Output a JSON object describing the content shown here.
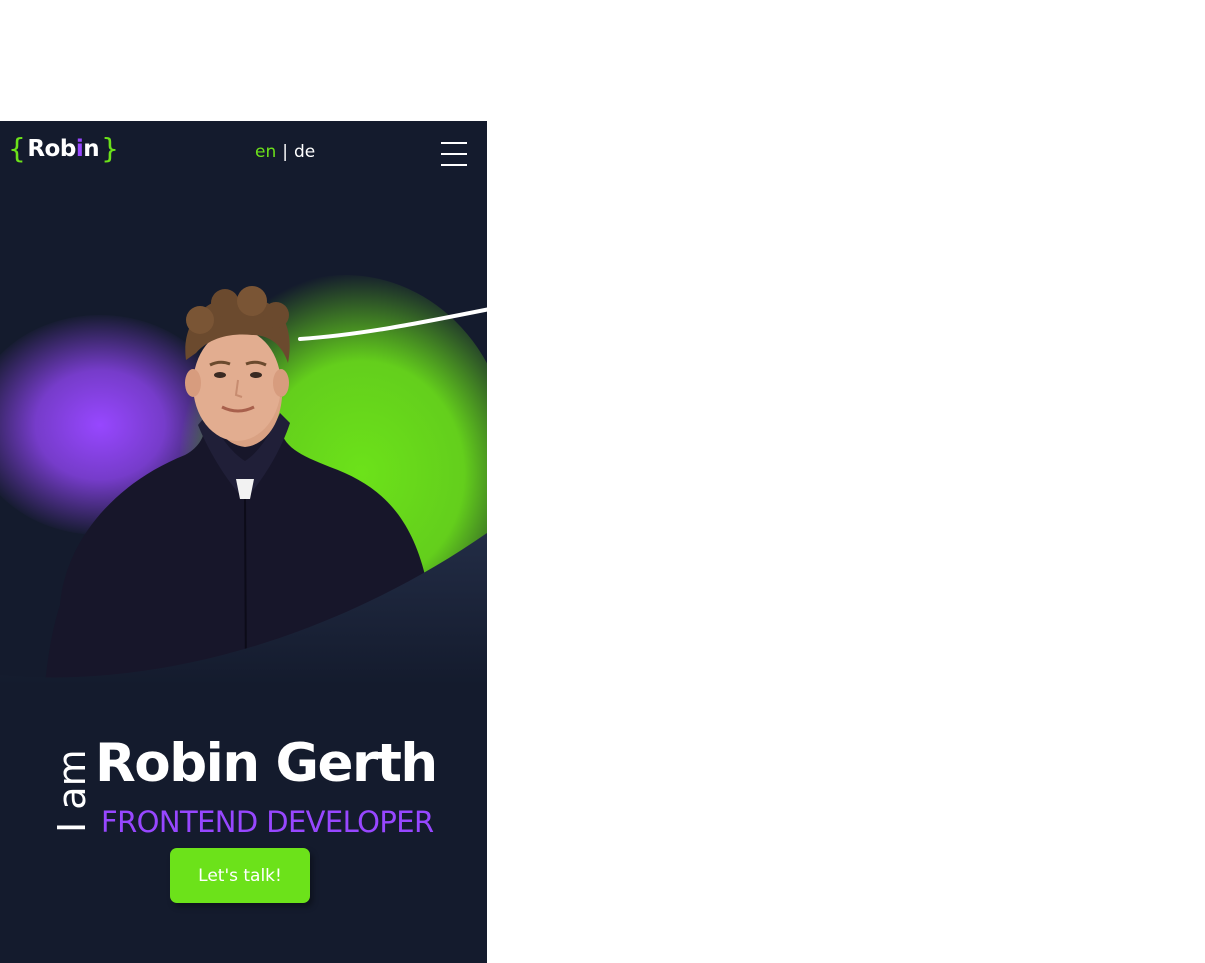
{
  "header": {
    "logo": {
      "open_brace": "{",
      "text_start": "Rob",
      "text_accent": "i",
      "text_end": "n",
      "close_brace": "}"
    },
    "language": {
      "active": "en",
      "separator": "|",
      "other": "de"
    },
    "menu_icon": "hamburger-menu-icon"
  },
  "hero": {
    "intro": "I am",
    "name": "Robin Gerth",
    "role": "FRONTEND DEVELOPER",
    "cta_label": "Let's talk!"
  },
  "colors": {
    "background": "#141b2d",
    "accent_green": "#6ce21a",
    "accent_purple": "#9747ff",
    "text": "#ffffff"
  }
}
